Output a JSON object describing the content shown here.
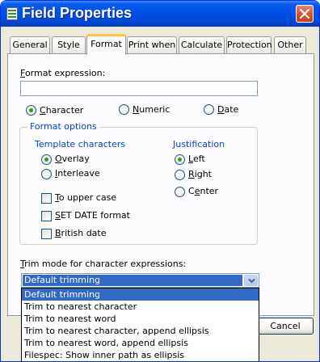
{
  "window": {
    "title": "Field Properties",
    "icon": "form-icon",
    "close_icon": "close-icon"
  },
  "tabs": [
    {
      "label": "General"
    },
    {
      "label": "Style"
    },
    {
      "label": "Format",
      "active": true
    },
    {
      "label": "Print when"
    },
    {
      "label": "Calculate"
    },
    {
      "label": "Protection"
    },
    {
      "label": "Other"
    }
  ],
  "format": {
    "expression_label": "Format expression:",
    "expression_value": "",
    "type_options": [
      {
        "label": "Character",
        "selected": true
      },
      {
        "label": "Numeric",
        "selected": false
      },
      {
        "label": "Date",
        "selected": false
      }
    ],
    "options_group": {
      "caption": "Format options",
      "template_caption": "Template characters",
      "template_options": [
        {
          "label": "Overlay",
          "selected": true
        },
        {
          "label": "Interleave",
          "selected": false
        }
      ],
      "justification_caption": "Justification",
      "justification_options": [
        {
          "label": "Left",
          "selected": true
        },
        {
          "label": "Right",
          "selected": false
        },
        {
          "label": "Center",
          "selected": false
        }
      ],
      "checkboxes": [
        {
          "label": "To upper case",
          "checked": false
        },
        {
          "label": "SET DATE format",
          "checked": false
        },
        {
          "label": "British date",
          "checked": false
        }
      ]
    },
    "trim_label": "Trim mode for character expressions:",
    "trim_selected": "Default trimming",
    "trim_options": [
      "Default trimming",
      "Trim to nearest character",
      "Trim to nearest word",
      "Trim to nearest character, append ellipsis",
      "Trim to nearest word, append ellipsis",
      "Filespec: Show inner path as ellipsis"
    ]
  },
  "buttons": {
    "cancel": "Cancel"
  },
  "colors": {
    "title_bar": "#0050e6",
    "selection": "#316ac5",
    "radio_dot": "#21a121",
    "group_caption": "#0046d5",
    "active_tab_highlight": "#ffc83c"
  }
}
